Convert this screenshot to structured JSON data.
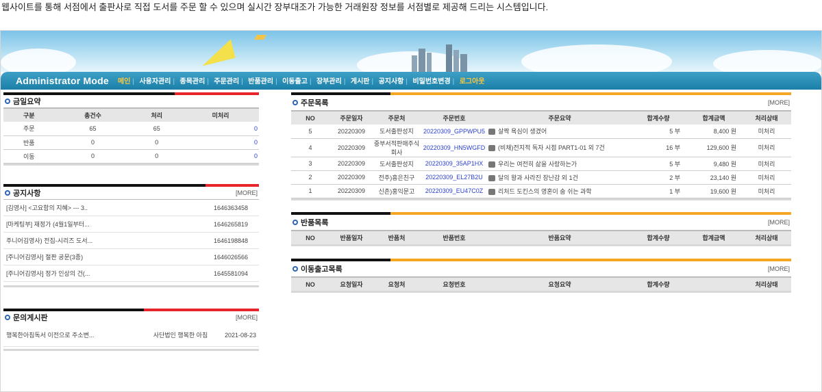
{
  "caption": "웹사이트를 통해 서점에서 출판사로 직접 도서를 주문 할 수 있으며 실시간 장부대조가 가능한 거래원장 정보를 서점별로 제공해 드리는 시스템입니다.",
  "admin_title": "Administrator Mode",
  "menu": [
    "메인",
    "사용자관리",
    "종목관리",
    "주문관리",
    "반품관리",
    "이동출고",
    "장부관리",
    "게시판",
    "공지사항",
    "비밀번호변경",
    "로그아웃"
  ],
  "more_label": "[MORE]",
  "summary": {
    "title": "금일요약",
    "headers": [
      "구분",
      "총건수",
      "처리",
      "미처리"
    ],
    "rows": [
      [
        "주문",
        "65",
        "65",
        "0"
      ],
      [
        "반품",
        "0",
        "0",
        "0"
      ],
      [
        "이동",
        "0",
        "0",
        "0"
      ]
    ]
  },
  "notice": {
    "title": "공지사항",
    "items": [
      [
        "[김영사] <고요함의 지혜> --- 3..",
        "1646363458"
      ],
      [
        "[마케팅부] 재정가 (4월1일부터...",
        "1646265819"
      ],
      [
        "주니어김영사) 전집-시리즈 도서...",
        "1646198848"
      ],
      [
        "[주니어김영사] 절판 공문(3종)",
        "1646026566"
      ],
      [
        "[주니어김영사] 정가 인상의 건(...",
        "1645581094"
      ]
    ]
  },
  "qna": {
    "title": "문의게시판",
    "items": [
      [
        "행복한아침독서 이전으로 주소변...",
        "사단법인 행복한 아침",
        "2021-08-23"
      ]
    ]
  },
  "orders": {
    "title": "주문목록",
    "headers": [
      "NO",
      "주문일자",
      "주문처",
      "주문번호",
      "주문요약",
      "합계수량",
      "합계금액",
      "처리상태"
    ],
    "rows": [
      [
        "5",
        "20220309",
        "도서출판성지",
        "20220309_GPPWPU5",
        "살짝 욕심이 생겼어",
        "5 부",
        "8,400 원",
        "미처리"
      ],
      [
        "4",
        "20220309",
        "중부서적판매주식회사",
        "20220309_HN5WGFD",
        "(비채)전지적 독자 시점 PART1-01 외 7건",
        "16 부",
        "129,600 원",
        "미처리"
      ],
      [
        "3",
        "20220309",
        "도서출판성지",
        "20220309_35AP1HX",
        "우리는 여전히 삶을 사랑하는가",
        "5 부",
        "9,480 원",
        "미처리"
      ],
      [
        "2",
        "20220309",
        "전주)흥은친구",
        "20220309_EL27B2U",
        "달의 왕과 사라진 장난감 외 1건",
        "2 부",
        "23,140 원",
        "미처리"
      ],
      [
        "1",
        "20220309",
        "신촌)홍익문고",
        "20220309_EU47C0Z",
        "리처드 도킨스의 영혼이 숨 쉬는 과학",
        "1 부",
        "19,600 원",
        "미처리"
      ]
    ]
  },
  "returns": {
    "title": "반품목록",
    "headers": [
      "NO",
      "반품일자",
      "반품처",
      "반품번호",
      "반품요약",
      "합계수량",
      "합계금액",
      "처리상태"
    ]
  },
  "transfers": {
    "title": "이동출고목록",
    "headers": [
      "NO",
      "요청일자",
      "요청처",
      "요청번호",
      "요청요약",
      "합계수량",
      "",
      "처리상태"
    ]
  },
  "colors": {
    "menu_bg": "#1b7fa8",
    "active": "#ffc93c",
    "red": "#e8242b",
    "orange": "#f5a623",
    "black": "#111111",
    "link": "#2a3fd0"
  }
}
